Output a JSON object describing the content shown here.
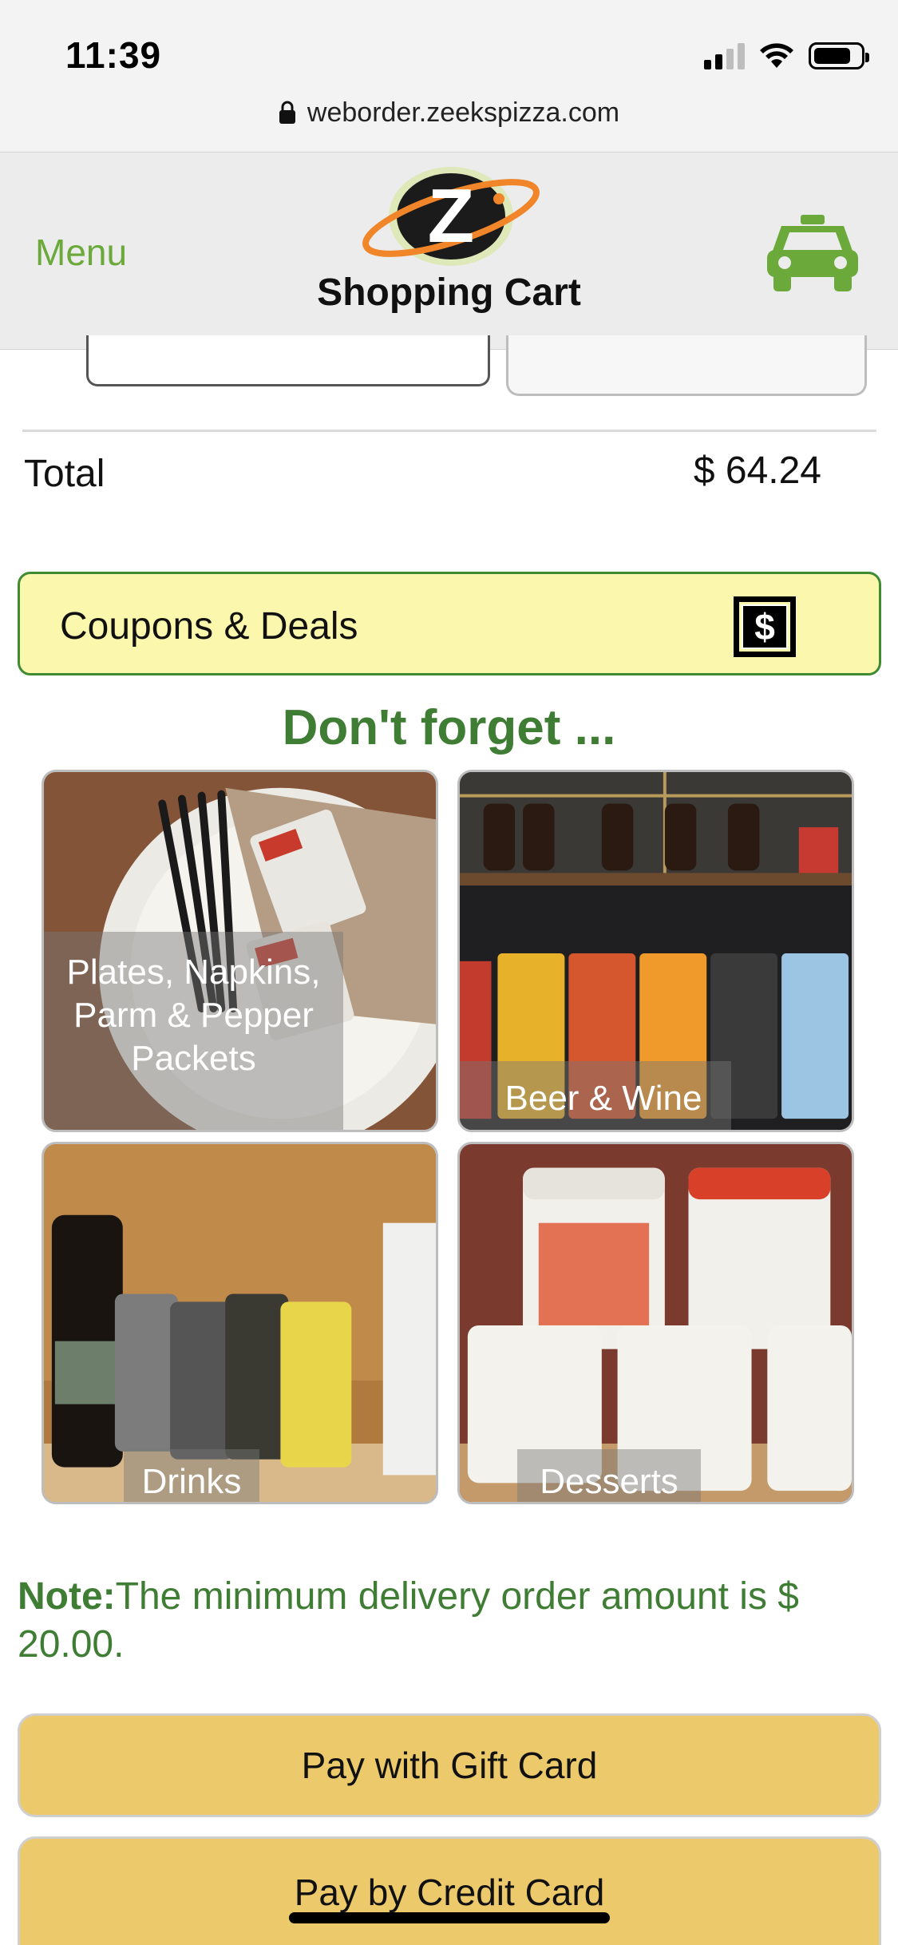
{
  "status_bar": {
    "time": "11:39",
    "url": "weborder.zeekspizza.com"
  },
  "header": {
    "menu_label": "Menu",
    "title": "Shopping Cart",
    "logo_letter": "Z"
  },
  "cart": {
    "total_label": "Total",
    "total_value": "$ 64.24"
  },
  "coupons": {
    "label": "Coupons & Deals",
    "icon": "dollar-icon"
  },
  "suggestions": {
    "heading": "Don't forget ...",
    "tiles": [
      {
        "label": "Plates, Napkins, Parm & Pepper Packets"
      },
      {
        "label": "Beer & Wine"
      },
      {
        "label": "Drinks"
      },
      {
        "label": "Desserts"
      }
    ]
  },
  "note": {
    "prefix": "Note:",
    "text": "The minimum delivery order amount is $ 20.00."
  },
  "payment": {
    "gift_card_label": "Pay with Gift Card",
    "credit_card_label": "Pay by Credit Card"
  },
  "colors": {
    "accent_green": "#6aa93a",
    "heading_green": "#3e7d33",
    "coupon_bg": "#fbf7ad",
    "pay_button": "#ecc96a"
  }
}
